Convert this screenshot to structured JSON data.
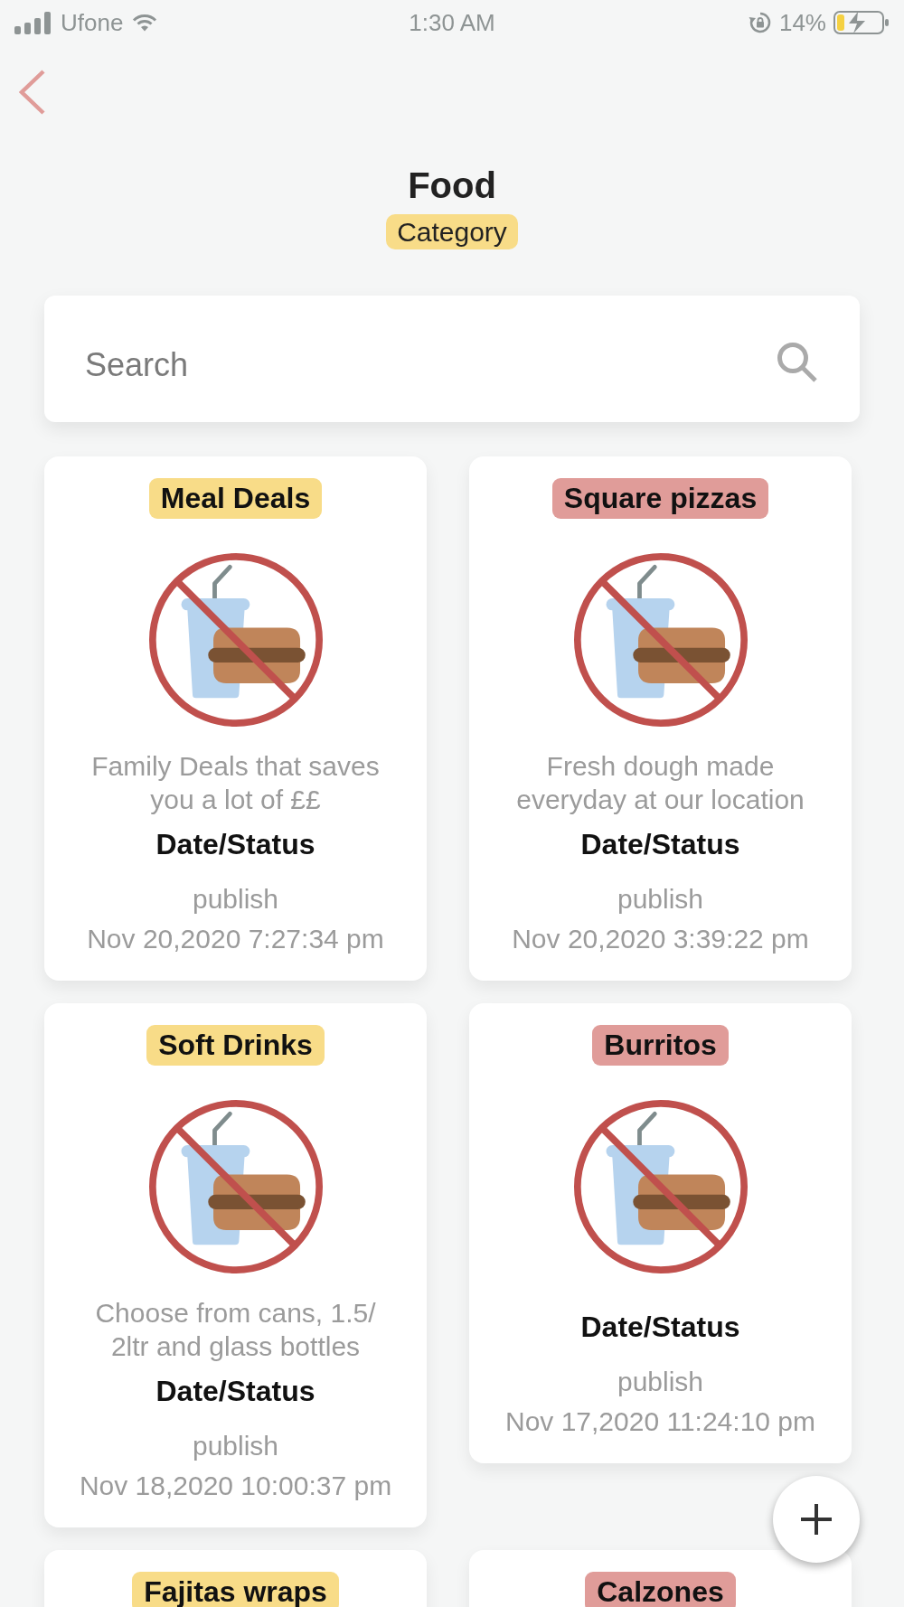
{
  "status_bar": {
    "carrier": "Ufone",
    "time": "1:30 AM",
    "battery": "14%"
  },
  "header": {
    "title": "Food",
    "subtitle": "Category"
  },
  "search": {
    "placeholder": "Search"
  },
  "items": [
    {
      "name": "Meal Deals",
      "color": "#f8dc88",
      "description": "Family Deals that saves you a lot of ££",
      "status_label": "Date/Status",
      "status": "publish",
      "date": "Nov 20,2020 7:27:34 pm"
    },
    {
      "name": "Square pizzas",
      "color": "#e09c99",
      "description": "Fresh dough made everyday at our location",
      "status_label": "Date/Status",
      "status": "publish",
      "date": "Nov 20,2020 3:39:22 pm"
    },
    {
      "name": "Soft Drinks",
      "color": "#f8dc88",
      "description": "Choose from cans, 1.5/2ltr and glass bottles",
      "status_label": "Date/Status",
      "status": "publish",
      "date": "Nov 18,2020 10:00:37 pm"
    },
    {
      "name": "Burritos",
      "color": "#e09c99",
      "status_label": "Date/Status",
      "status": "publish",
      "date": "Nov 17,2020 11:24:10 pm"
    },
    {
      "name": "Fajitas wraps",
      "color": "#f8dc88"
    },
    {
      "name": "Calzones",
      "color": "#e09c99"
    }
  ]
}
